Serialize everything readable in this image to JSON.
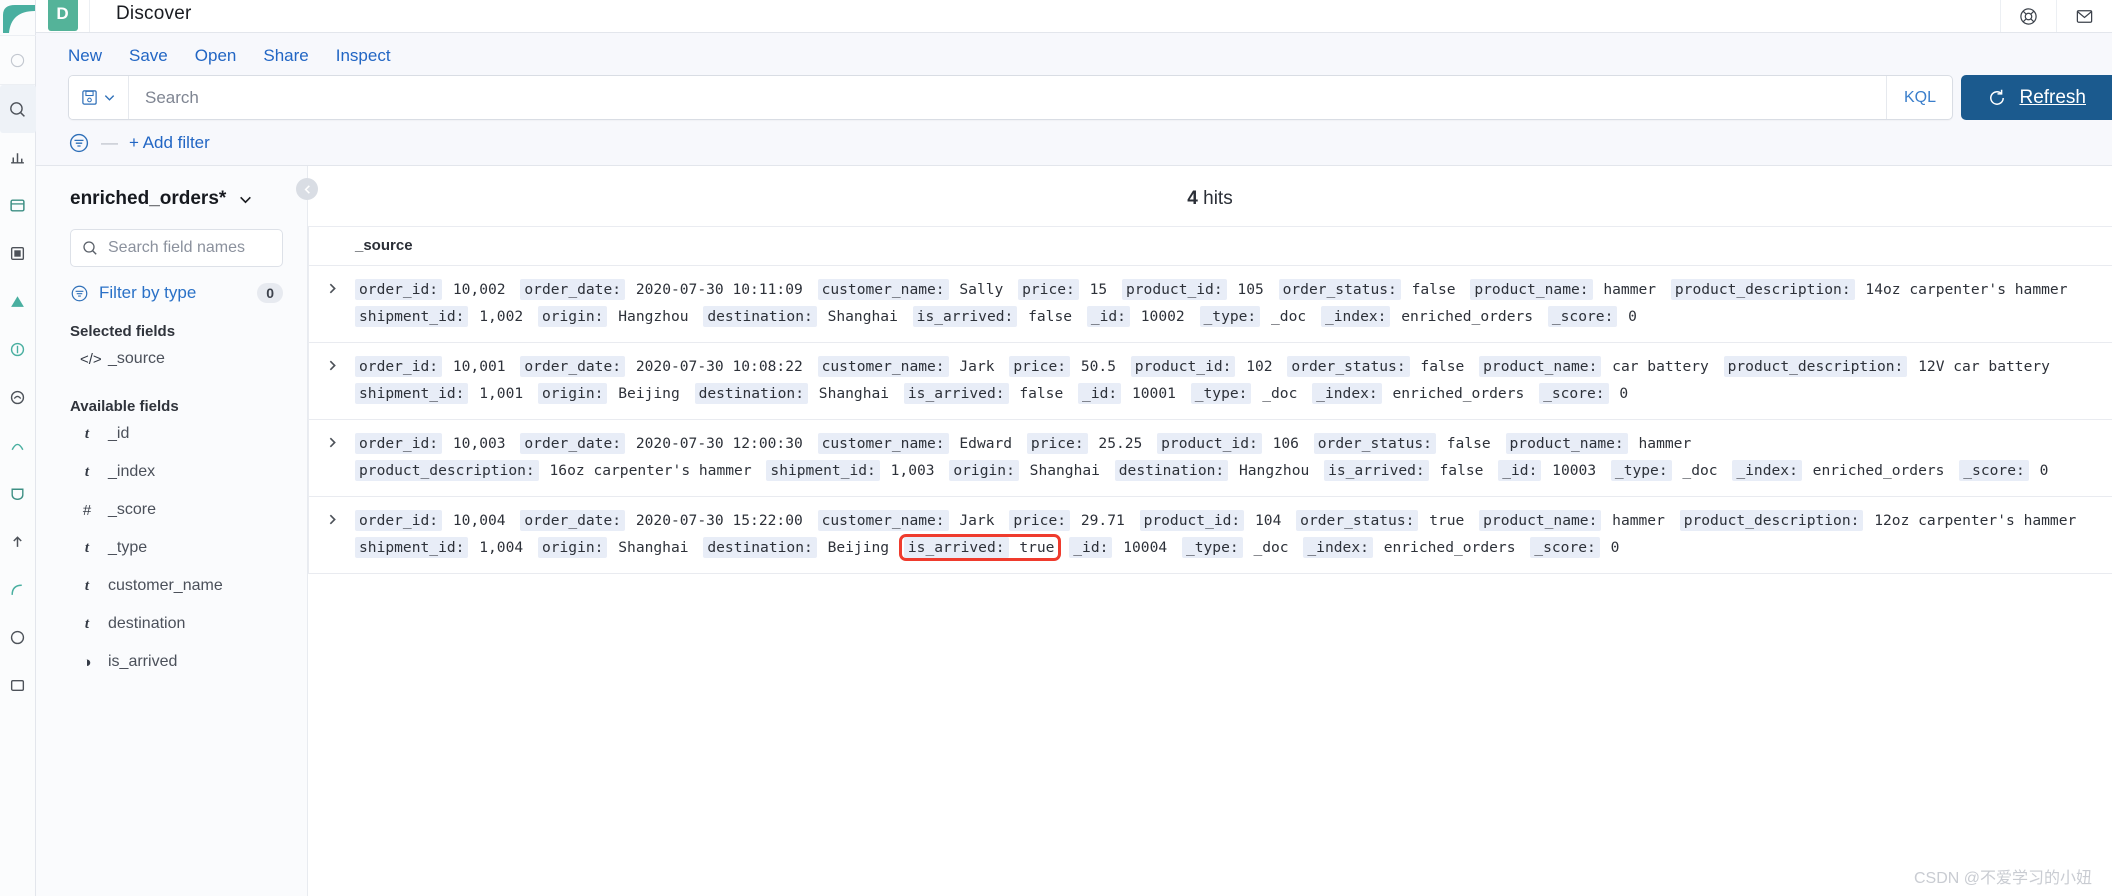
{
  "chrome": {
    "app_badge": "D",
    "title": "Discover",
    "help_icon": "lifebuoy-icon",
    "mail_icon": "mail-icon"
  },
  "topmenu": [
    {
      "label": "New",
      "name": "new-button"
    },
    {
      "label": "Save",
      "name": "save-button"
    },
    {
      "label": "Open",
      "name": "open-button"
    },
    {
      "label": "Share",
      "name": "share-button"
    },
    {
      "label": "Inspect",
      "name": "inspect-button"
    }
  ],
  "search": {
    "placeholder": "Search",
    "value": "",
    "save_icon": "floppy-disk-icon",
    "chevron_icon": "chevron-down-icon",
    "language": "KQL",
    "refresh_label": "Refresh",
    "refresh_icon": "refresh-icon",
    "refresh_color": "#1b5a8e"
  },
  "filterbar": {
    "filter_icon": "filter-icon",
    "dash": "—",
    "add_filter_label": "+ Add filter"
  },
  "sidebar": {
    "index_pattern": "enriched_orders*",
    "index_chevron_icon": "chevron-down-icon",
    "field_search_placeholder": "Search field names",
    "search_icon": "search-icon",
    "filter_by_type_label": "Filter by type",
    "filter_by_type_icon": "filter-icon",
    "filter_by_type_count": "0",
    "selected_fields_label": "Selected fields",
    "available_fields_label": "Available fields",
    "selected_fields": [
      {
        "name": "_source",
        "type_glyph": "</>",
        "type": "source"
      }
    ],
    "available_fields": [
      {
        "name": "_id",
        "type_glyph": "t",
        "type": "string"
      },
      {
        "name": "_index",
        "type_glyph": "t",
        "type": "string"
      },
      {
        "name": "_score",
        "type_glyph": "#",
        "type": "number"
      },
      {
        "name": "_type",
        "type_glyph": "t",
        "type": "string"
      },
      {
        "name": "customer_name",
        "type_glyph": "t",
        "type": "string"
      },
      {
        "name": "destination",
        "type_glyph": "t",
        "type": "string"
      },
      {
        "name": "is_arrived",
        "type_glyph": "◑",
        "type": "boolean"
      }
    ],
    "collapse_icon": "chevron-left-icon"
  },
  "main": {
    "hits_count": "4",
    "hits_label": "hits",
    "column_header": "_source",
    "documents": [
      {
        "expand_icon": "chevron-right-icon",
        "fields": [
          {
            "key": "order_id:",
            "value": "10,002"
          },
          {
            "key": "order_date:",
            "value": "2020-07-30 10:11:09"
          },
          {
            "key": "customer_name:",
            "value": "Sally"
          },
          {
            "key": "price:",
            "value": "15"
          },
          {
            "key": "product_id:",
            "value": "105"
          },
          {
            "key": "order_status:",
            "value": "false"
          },
          {
            "key": "product_name:",
            "value": "hammer"
          },
          {
            "key": "product_description:",
            "value": "14oz carpenter's hammer"
          },
          {
            "key": "shipment_id:",
            "value": "1,002"
          },
          {
            "key": "origin:",
            "value": "Hangzhou"
          },
          {
            "key": "destination:",
            "value": "Shanghai"
          },
          {
            "key": "is_arrived:",
            "value": "false"
          },
          {
            "key": "_id:",
            "value": "10002"
          },
          {
            "key": "_type:",
            "value": "_doc"
          },
          {
            "key": "_index:",
            "value": "enriched_orders"
          },
          {
            "key": "_score:",
            "value": "0"
          }
        ]
      },
      {
        "expand_icon": "chevron-right-icon",
        "fields": [
          {
            "key": "order_id:",
            "value": "10,001"
          },
          {
            "key": "order_date:",
            "value": "2020-07-30 10:08:22"
          },
          {
            "key": "customer_name:",
            "value": "Jark"
          },
          {
            "key": "price:",
            "value": "50.5"
          },
          {
            "key": "product_id:",
            "value": "102"
          },
          {
            "key": "order_status:",
            "value": "false"
          },
          {
            "key": "product_name:",
            "value": "car battery"
          },
          {
            "key": "product_description:",
            "value": "12V car battery"
          },
          {
            "key": "shipment_id:",
            "value": "1,001"
          },
          {
            "key": "origin:",
            "value": "Beijing"
          },
          {
            "key": "destination:",
            "value": "Shanghai"
          },
          {
            "key": "is_arrived:",
            "value": "false"
          },
          {
            "key": "_id:",
            "value": "10001"
          },
          {
            "key": "_type:",
            "value": "_doc"
          },
          {
            "key": "_index:",
            "value": "enriched_orders"
          },
          {
            "key": "_score:",
            "value": "0"
          }
        ]
      },
      {
        "expand_icon": "chevron-right-icon",
        "fields": [
          {
            "key": "order_id:",
            "value": "10,003"
          },
          {
            "key": "order_date:",
            "value": "2020-07-30 12:00:30"
          },
          {
            "key": "customer_name:",
            "value": "Edward"
          },
          {
            "key": "price:",
            "value": "25.25"
          },
          {
            "key": "product_id:",
            "value": "106"
          },
          {
            "key": "order_status:",
            "value": "false"
          },
          {
            "key": "product_name:",
            "value": "hammer"
          },
          {
            "key": "product_description:",
            "value": "16oz carpenter's hammer"
          },
          {
            "key": "shipment_id:",
            "value": "1,003"
          },
          {
            "key": "origin:",
            "value": "Shanghai"
          },
          {
            "key": "destination:",
            "value": "Hangzhou"
          },
          {
            "key": "is_arrived:",
            "value": "false"
          },
          {
            "key": "_id:",
            "value": "10003"
          },
          {
            "key": "_type:",
            "value": "_doc"
          },
          {
            "key": "_index:",
            "value": "enriched_orders"
          },
          {
            "key": "_score:",
            "value": "0"
          }
        ]
      },
      {
        "expand_icon": "chevron-right-icon",
        "fields": [
          {
            "key": "order_id:",
            "value": "10,004"
          },
          {
            "key": "order_date:",
            "value": "2020-07-30 15:22:00"
          },
          {
            "key": "customer_name:",
            "value": "Jark"
          },
          {
            "key": "price:",
            "value": "29.71"
          },
          {
            "key": "product_id:",
            "value": "104"
          },
          {
            "key": "order_status:",
            "value": "true"
          },
          {
            "key": "product_name:",
            "value": "hammer"
          },
          {
            "key": "product_description:",
            "value": "12oz carpenter's hammer"
          },
          {
            "key": "shipment_id:",
            "value": "1,004"
          },
          {
            "key": "origin:",
            "value": "Shanghai"
          },
          {
            "key": "destination:",
            "value": "Beijing"
          },
          {
            "key": "is_arrived:",
            "value": "true",
            "highlight": true
          },
          {
            "key": "_id:",
            "value": "10004"
          },
          {
            "key": "_type:",
            "value": "_doc"
          },
          {
            "key": "_index:",
            "value": "enriched_orders"
          },
          {
            "key": "_score:",
            "value": "0"
          }
        ]
      }
    ]
  },
  "watermark": "CSDN @不爱学习的小妞",
  "colors": {
    "accent_blue": "#2266c4",
    "badge_green": "#54b399",
    "highlight_red": "#ef3b2d",
    "key_chip_bg": "#e8edf7"
  }
}
